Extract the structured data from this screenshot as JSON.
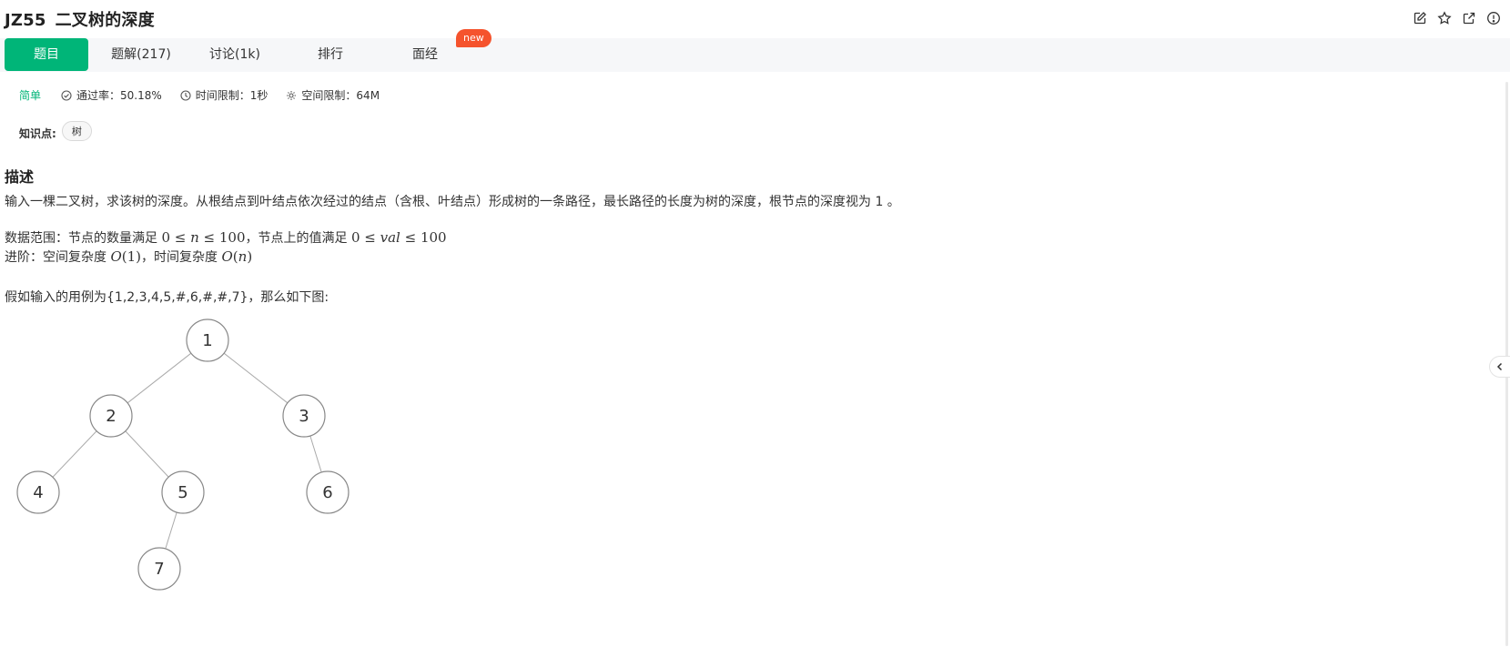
{
  "header": {
    "code": "JZ55",
    "title": "二叉树的深度"
  },
  "tabs": [
    {
      "label": "题目",
      "active": true
    },
    {
      "label": "题解(217)"
    },
    {
      "label": "讨论(1k)"
    },
    {
      "label": "排行"
    },
    {
      "label": "面经"
    }
  ],
  "new_badge": "new",
  "meta": {
    "difficulty": "简单",
    "pass_rate": "通过率：50.18%",
    "time_limit": "时间限制：1秒",
    "space_limit": "空间限制：64M"
  },
  "knowledge": {
    "label": "知识点:",
    "tags": [
      "树"
    ]
  },
  "description": {
    "heading": "描述",
    "intro": "输入一棵二叉树，求该树的深度。从根结点到叶结点依次经过的结点（含根、叶结点）形成树的一条路径，最长路径的长度为树的深度，根节点的深度视为 1 。",
    "range_prefix": "数据范围：节点的数量满足",
    "range_middle": "，节点上的值满足",
    "advanced_prefix": "进阶：空间复杂度",
    "advanced_middle": "，时间复杂度",
    "example": "假如输入的用例为{1,2,3,4,5,#,6,#,#,7}，那么如下图:"
  },
  "tree": {
    "nodes": [
      {
        "id": "1",
        "parent": null
      },
      {
        "id": "2",
        "parent": "1"
      },
      {
        "id": "3",
        "parent": "1"
      },
      {
        "id": "4",
        "parent": "2"
      },
      {
        "id": "5",
        "parent": "2"
      },
      {
        "id": "6",
        "parent": "3"
      },
      {
        "id": "7",
        "parent": "5"
      }
    ]
  },
  "colors": {
    "accent": "#00b578",
    "badge": "#f5532d",
    "tabbar_bg": "#f6f7f9"
  },
  "icons": [
    "edit-icon",
    "star-icon",
    "external-link-icon",
    "info-icon",
    "check-circle-icon",
    "clock-icon",
    "settings-icon",
    "chevron-left-icon"
  ]
}
